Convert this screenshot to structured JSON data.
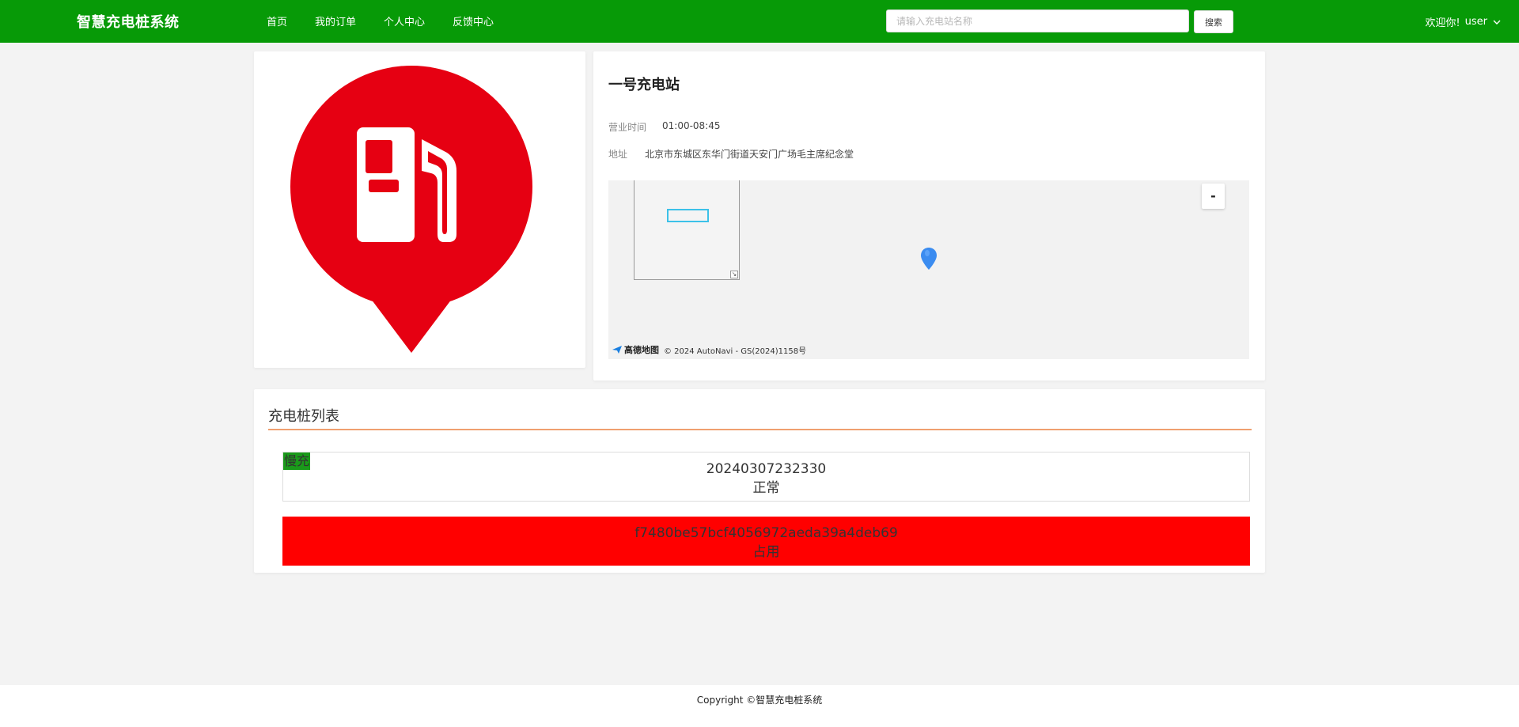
{
  "header": {
    "brand": "智慧充电桩系统",
    "nav": [
      "首页",
      "我的订单",
      "个人中心",
      "反馈中心"
    ],
    "search_placeholder": "请输入充电站名称",
    "search_button": "搜索",
    "welcome": "欢迎你!",
    "username": "user",
    "brand_color": "#079a07"
  },
  "station": {
    "name": "一号充电站",
    "hours_label": "营业时间",
    "hours_value": "01:00-08:45",
    "address_label": "地址",
    "address_value": "北京市东城区东华门街道天安门广场毛主席纪念堂",
    "logo_icon": "fuel-station-icon",
    "logo_color": "#e60012"
  },
  "map": {
    "zoom_out_label": "-",
    "resize_glyph": "↘",
    "provider_logo_text": "高德地图",
    "copyright": "© 2024 AutoNavi - GS(2024)1158号",
    "pin_color": "#3b8cf0"
  },
  "pile_list": {
    "title": "充电桩列表",
    "items": [
      {
        "tag": "慢充",
        "code": "20240307232330",
        "status": "正常",
        "status_color": "#ffffff"
      },
      {
        "tag": "",
        "code": "f7480be57bcf4056972aeda39a4deb69",
        "status": "占用",
        "status_color": "#ff0000"
      }
    ]
  },
  "footer": {
    "copyright": "Copyright ©智慧充电桩系统"
  }
}
